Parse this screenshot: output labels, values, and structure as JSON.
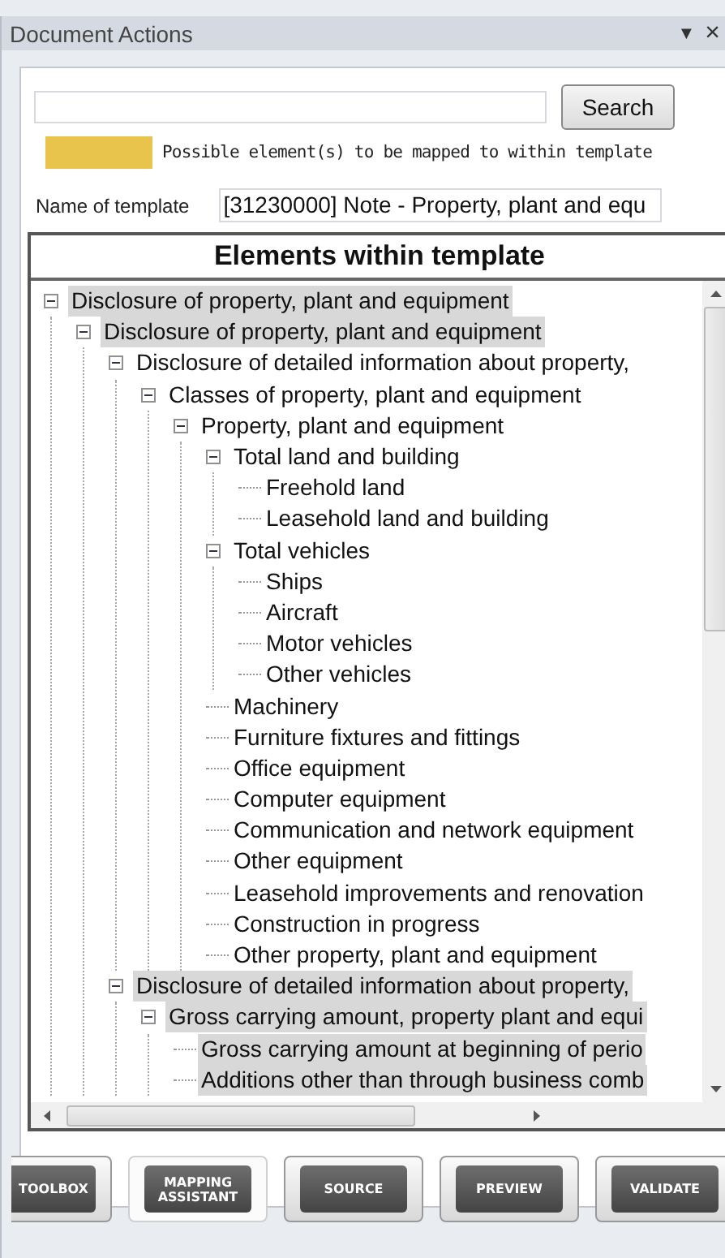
{
  "panel": {
    "title": "Document Actions",
    "menu_glyph": "▼",
    "close_glyph": "×"
  },
  "search": {
    "button": "Search"
  },
  "legend": {
    "color": "#e8c44c",
    "text": "Possible element(s) to be mapped to within template"
  },
  "template": {
    "label": "Name of template",
    "value": "[31230000] Note - Property, plant and equ"
  },
  "tree": {
    "header": "Elements within template",
    "items": [
      {
        "label": "Disclosure of property, plant and equipment",
        "highlighted": true,
        "expanded": true,
        "children": [
          {
            "label": "Disclosure of property, plant and equipment",
            "highlighted": true,
            "expanded": true,
            "children": [
              {
                "label": "Disclosure of detailed information about property,",
                "highlighted": false,
                "expanded": true,
                "children": [
                  {
                    "label": "Classes of property, plant and equipment",
                    "highlighted": false,
                    "expanded": true,
                    "children": [
                      {
                        "label": "Property, plant and equipment",
                        "highlighted": false,
                        "expanded": true,
                        "children": [
                          {
                            "label": "Total land and building",
                            "highlighted": false,
                            "expanded": true,
                            "children": [
                              {
                                "label": "Freehold land",
                                "highlighted": false
                              },
                              {
                                "label": "Leasehold land and building",
                                "highlighted": false
                              }
                            ]
                          },
                          {
                            "label": "Total vehicles",
                            "highlighted": false,
                            "expanded": true,
                            "children": [
                              {
                                "label": "Ships",
                                "highlighted": false
                              },
                              {
                                "label": "Aircraft",
                                "highlighted": false
                              },
                              {
                                "label": "Motor vehicles",
                                "highlighted": false
                              },
                              {
                                "label": "Other vehicles",
                                "highlighted": false
                              }
                            ]
                          },
                          {
                            "label": "Machinery",
                            "highlighted": false
                          },
                          {
                            "label": "Furniture fixtures and fittings",
                            "highlighted": false
                          },
                          {
                            "label": "Office equipment",
                            "highlighted": false
                          },
                          {
                            "label": "Computer equipment",
                            "highlighted": false
                          },
                          {
                            "label": "Communication and network equipment",
                            "highlighted": false
                          },
                          {
                            "label": "Other equipment",
                            "highlighted": false
                          },
                          {
                            "label": "Leasehold improvements and renovation",
                            "highlighted": false
                          },
                          {
                            "label": "Construction in progress",
                            "highlighted": false
                          },
                          {
                            "label": "Other property, plant and equipment",
                            "highlighted": false
                          }
                        ]
                      }
                    ]
                  }
                ]
              },
              {
                "label": "Disclosure of detailed information about property,",
                "highlighted": true,
                "expanded": true,
                "children": [
                  {
                    "label": "Gross carrying amount, property plant and equi",
                    "highlighted": true,
                    "expanded": true,
                    "children": [
                      {
                        "label": "Gross carrying amount at beginning of perio",
                        "highlighted": true
                      },
                      {
                        "label": "Additions other than through business comb",
                        "highlighted": true
                      }
                    ]
                  }
                ]
              }
            ]
          }
        ]
      }
    ]
  },
  "buttons": [
    {
      "label": "TOOLBOX",
      "selected": false
    },
    {
      "label": "MAPPING ASSISTANT",
      "selected": true
    },
    {
      "label": "SOURCE",
      "selected": false
    },
    {
      "label": "PREVIEW",
      "selected": false
    },
    {
      "label": "VALIDATE",
      "selected": false
    }
  ]
}
